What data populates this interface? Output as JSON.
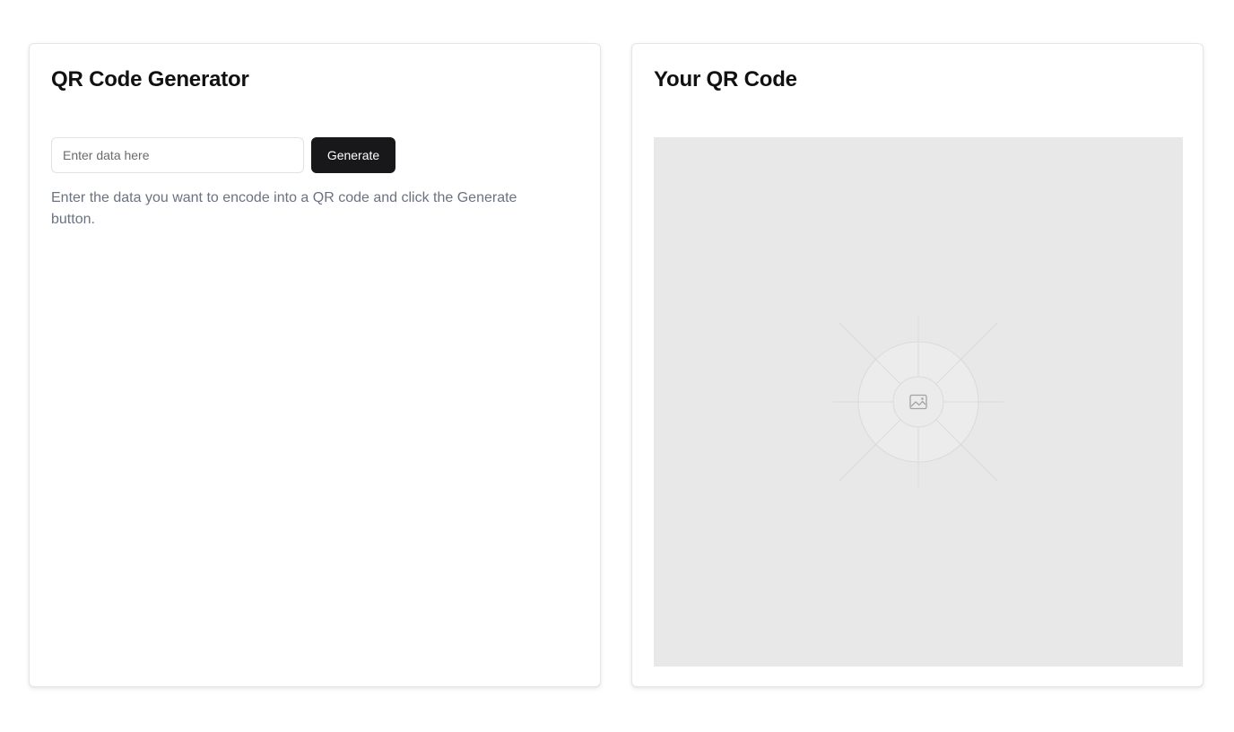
{
  "generator": {
    "title": "QR Code Generator",
    "input_placeholder": "Enter data here",
    "input_value": "",
    "generate_label": "Generate",
    "help_text": "Enter the data you want to encode into a QR code and click the Generate button."
  },
  "output": {
    "title": "Your QR Code",
    "placeholder_icon": "image-icon"
  },
  "colors": {
    "button_bg": "#18181b",
    "placeholder_bg": "#e8e8e8",
    "help_text": "#6b7280"
  }
}
